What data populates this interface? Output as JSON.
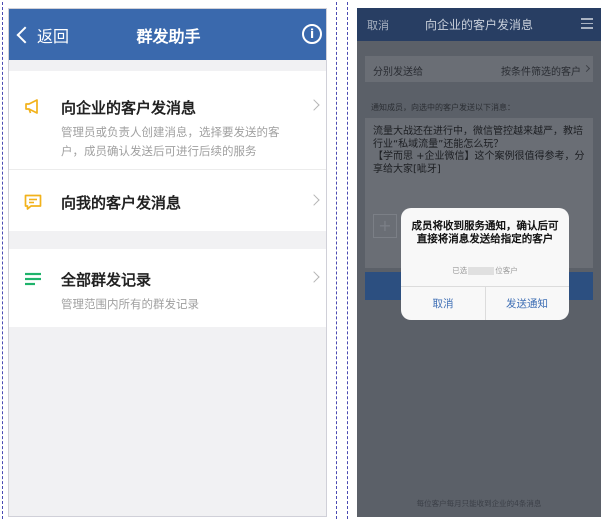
{
  "left_screen": {
    "header": {
      "back_label": "返回",
      "title": "群发助手",
      "info_icon": "i"
    },
    "items": [
      {
        "icon": "megaphone-icon",
        "title": "向企业的客户发消息",
        "description": "管理员或负责人创建消息，选择要发送的客户，成员确认发送后可进行后续的服务"
      },
      {
        "icon": "chat-bubble-icon",
        "title": "向我的客户发消息"
      },
      {
        "icon": "list-icon",
        "title": "全部群发记录",
        "description": "管理范围内所有的群发记录"
      }
    ],
    "colors": {
      "header": "#3a69ad",
      "icon_yellow": "#f2b21b",
      "icon_green": "#1fb36b"
    }
  },
  "right_screen": {
    "header": {
      "cancel_label": "取消",
      "title": "向企业的客户发消息",
      "menu_icon": "menu-icon"
    },
    "send_scope": {
      "label": "分别发送给",
      "value": "按条件筛选的客户"
    },
    "hint": "通知成员，向选中的客户发送以下消息：",
    "message": "流量大战还在进行中，微信管控越来越严，教培行业“私域流量”还能怎么玩？\n【学而思 +企业微信】这个案例很值得参考，分享给大家[呲牙]",
    "plus_label": "+",
    "footer": "每位客户每月只能收到企业的4条消息",
    "dialog": {
      "title": "成员将收到服务通知，确认后可直接将消息发送给指定的客户",
      "subtitle_prefix": "已选",
      "subtitle_suffix": "位客户",
      "cancel_label": "取消",
      "confirm_label": "发送通知"
    }
  }
}
